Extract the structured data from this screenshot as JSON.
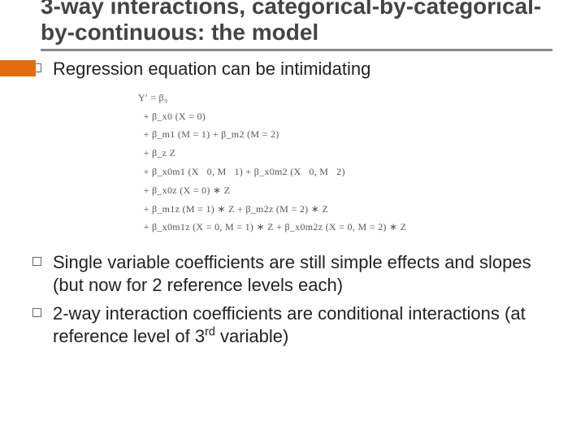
{
  "title": "3-way interactions, categorical-by-categorical-by-continuous: the model",
  "bullets": {
    "b0": "Regression equation can be intimidating",
    "b1": "Single variable coefficients are still simple effects and slopes (but now for 2 reference levels each)",
    "b2_pre": "2-way interaction coefficients are conditional interactions (at reference level of 3",
    "b2_sup": "rd",
    "b2_post": " variable)"
  },
  "equation": {
    "l0": "Y′ = β₀",
    "l1": "  + β_x0 (X = 0)",
    "l2": "  + β_m1 (M = 1) + β_m2 (M = 2)",
    "l3": "  + β_z Z",
    "l4": "  + β_x0m1 (X   0, M   1) + β_x0m2 (X   0, M   2)",
    "l5": "  + β_x0z (X = 0) ∗ Z",
    "l6": "  + β_m1z (M = 1) ∗ Z + β_m2z (M = 2) ∗ Z",
    "l7": "  + β_x0m1z (X = 0, M = 1) ∗ Z + β_x0m2z (X = 0, M = 2) ∗ Z"
  }
}
